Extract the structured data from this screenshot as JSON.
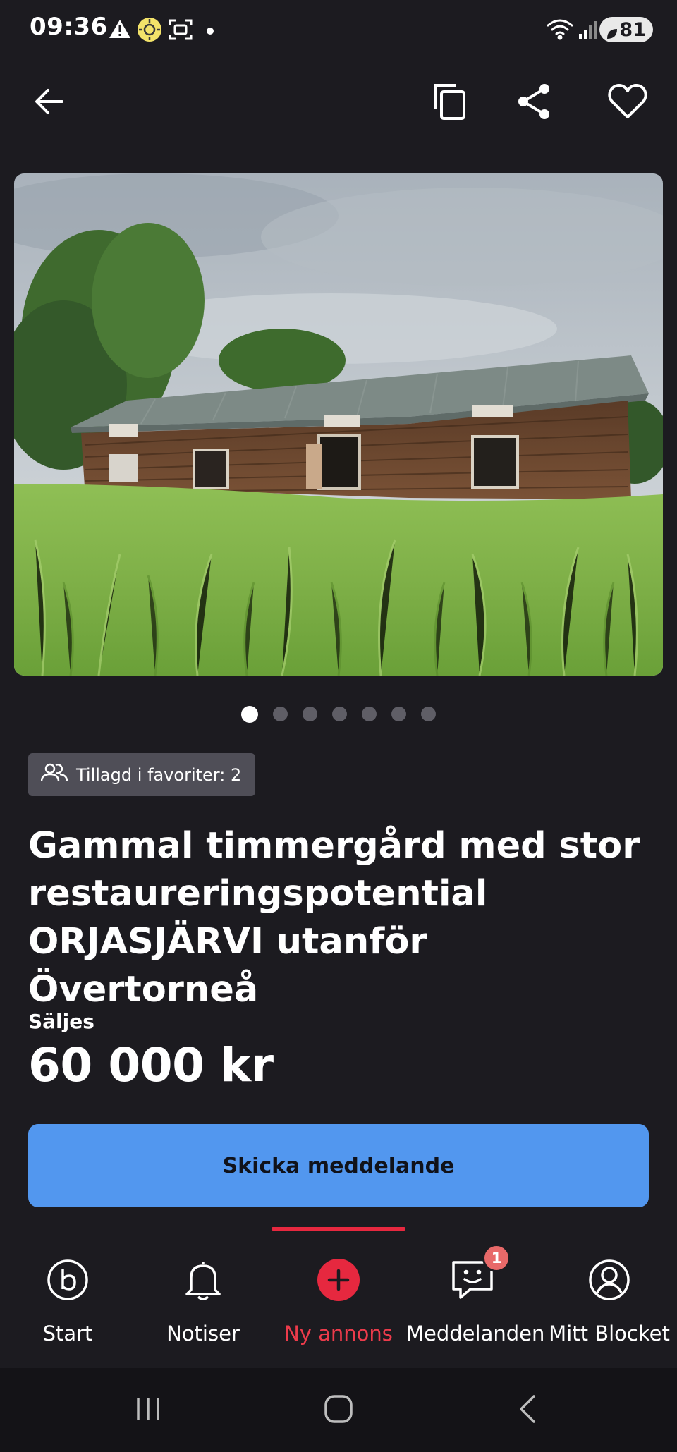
{
  "status_bar": {
    "time": "09:36",
    "battery": "81",
    "icons": [
      "warning-icon",
      "sun-app-icon",
      "screenshot-icon",
      "dot-icon",
      "wifi-icon",
      "signal-icon",
      "battery-icon"
    ]
  },
  "app_bar": {
    "icons": [
      "back-arrow-icon",
      "copy-icon",
      "share-icon",
      "heart-icon"
    ]
  },
  "gallery": {
    "total_images": 7,
    "current_index": 1
  },
  "listing": {
    "favorites_badge": "Tillagd i favoriter: 2",
    "title_line1": "Gammal timmergård med stor",
    "title_line2": "restaureringspotential",
    "title_line3": "ORJASJÄRVI utanför Övertorneå",
    "sale_type": "Säljes",
    "price": "60 000 kr",
    "cta_label": "Skicka meddelande"
  },
  "bottom_nav": {
    "items": [
      {
        "label": "Start",
        "icon": "blocket-b-icon"
      },
      {
        "label": "Notiser",
        "icon": "bell-icon"
      },
      {
        "label": "Ny annons",
        "icon": "plus-circle-icon",
        "active": true
      },
      {
        "label": "Meddelanden",
        "icon": "chat-icon",
        "badge": "1"
      },
      {
        "label": "Mitt Blocket",
        "icon": "profile-icon"
      }
    ]
  },
  "colors": {
    "background": "#1c1b20",
    "accent_red": "#e6283f",
    "cta_blue": "#5297ef",
    "badge_gray": "#4f4e57"
  }
}
